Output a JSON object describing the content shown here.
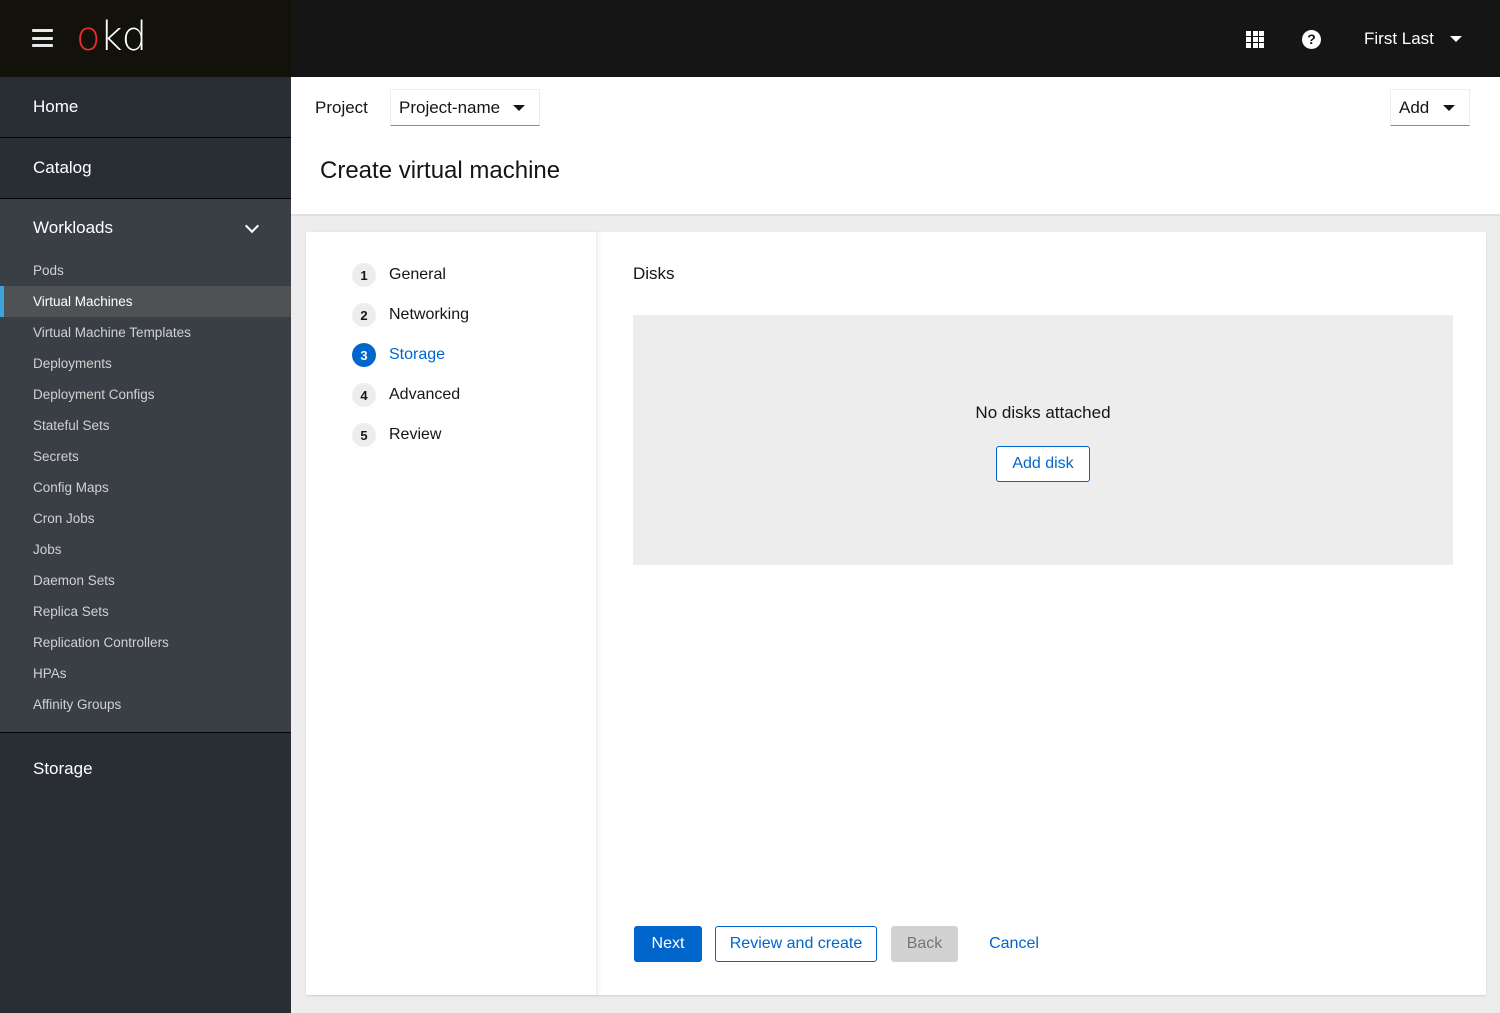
{
  "masthead": {
    "brand_o": "o",
    "brand_rest": "kd",
    "menu_icon": "hamburger-icon",
    "apps_icon": "grid-icon",
    "help_icon": "question-circle-icon",
    "help_glyph": "?",
    "user_name": "First Last"
  },
  "sidebar": {
    "home": "Home",
    "catalog": "Catalog",
    "workloads": {
      "label": "Workloads",
      "expanded": true,
      "items": [
        {
          "label": "Pods",
          "active": false
        },
        {
          "label": "Virtual Machines",
          "active": true
        },
        {
          "label": "Virtual Machine Templates",
          "active": false
        },
        {
          "label": "Deployments",
          "active": false
        },
        {
          "label": "Deployment Configs",
          "active": false
        },
        {
          "label": "Stateful Sets",
          "active": false
        },
        {
          "label": "Secrets",
          "active": false
        },
        {
          "label": "Config Maps",
          "active": false
        },
        {
          "label": "Cron Jobs",
          "active": false
        },
        {
          "label": "Jobs",
          "active": false
        },
        {
          "label": "Daemon Sets",
          "active": false
        },
        {
          "label": "Replica Sets",
          "active": false
        },
        {
          "label": "Replication Controllers",
          "active": false
        },
        {
          "label": "HPAs",
          "active": false
        },
        {
          "label": "Affinity Groups",
          "active": false
        }
      ]
    },
    "storage": "Storage"
  },
  "header": {
    "project_label": "Project",
    "project_value": "Project-name",
    "add_label": "Add",
    "title": "Create virtual machine"
  },
  "wizard": {
    "steps": [
      {
        "number": "1",
        "label": "General"
      },
      {
        "number": "2",
        "label": "Networking"
      },
      {
        "number": "3",
        "label": "Storage"
      },
      {
        "number": "4",
        "label": "Advanced"
      },
      {
        "number": "5",
        "label": "Review"
      }
    ],
    "current_step": 3,
    "section_title": "Disks",
    "empty_state": {
      "title": "No disks attached",
      "action": "Add disk"
    },
    "buttons": {
      "next": "Next",
      "review": "Review and create",
      "back": "Back",
      "cancel": "Cancel"
    }
  },
  "colors": {
    "primary": "#0066cc",
    "masthead": "#151515",
    "sidebar": "#292e34",
    "sidebar_section": "#393f44",
    "active_indicator": "#39a5dc",
    "brand_red": "#ee2d2d"
  }
}
